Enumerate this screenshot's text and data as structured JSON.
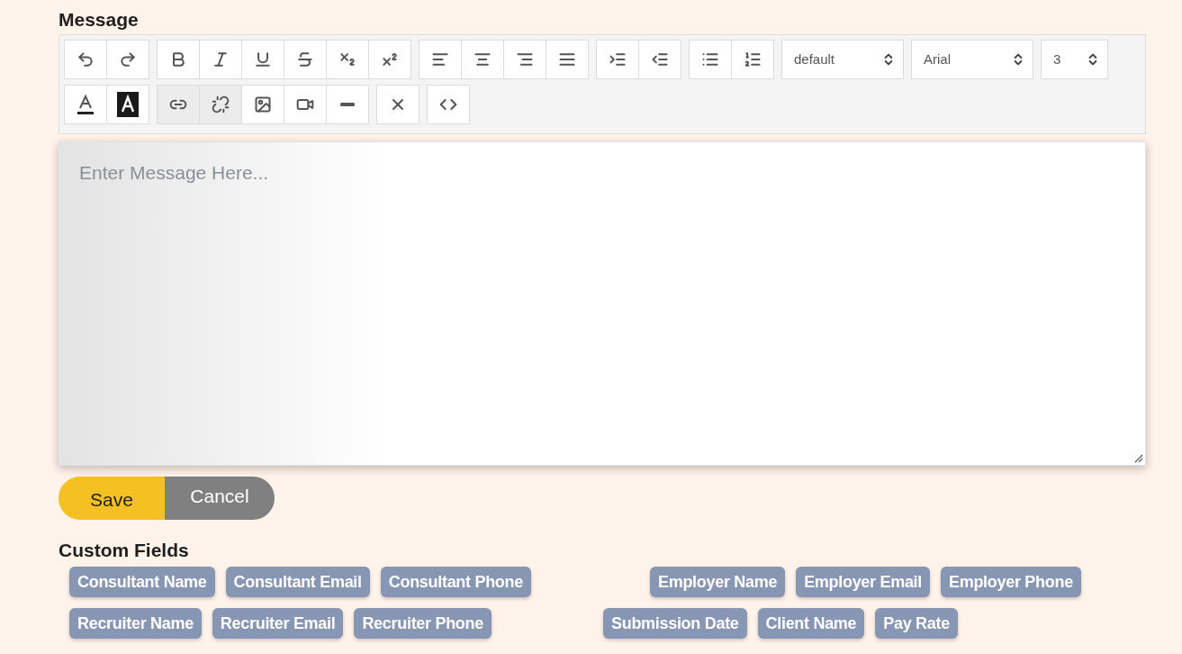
{
  "message_label": "Message",
  "toolbar": {
    "rows": [
      [
        {
          "buttons": [
            {
              "kind": "undo",
              "pressed": false
            },
            {
              "kind": "redo",
              "pressed": false
            }
          ]
        },
        {
          "buttons": [
            {
              "kind": "bold",
              "pressed": false
            },
            {
              "kind": "italic",
              "pressed": false
            },
            {
              "kind": "underline",
              "pressed": false
            },
            {
              "kind": "strikethrough",
              "pressed": false
            },
            {
              "kind": "subscript",
              "pressed": false
            },
            {
              "kind": "superscript",
              "pressed": false
            }
          ]
        },
        {
          "buttons": [
            {
              "kind": "align-left",
              "pressed": false
            },
            {
              "kind": "align-center",
              "pressed": false
            },
            {
              "kind": "align-right",
              "pressed": false
            },
            {
              "kind": "justify",
              "pressed": false
            }
          ]
        },
        {
          "buttons": [
            {
              "kind": "indent",
              "pressed": false
            },
            {
              "kind": "outdent",
              "pressed": false
            }
          ]
        },
        {
          "buttons": [
            {
              "kind": "bullet-list",
              "pressed": false
            },
            {
              "kind": "numbered-list",
              "pressed": false
            }
          ]
        }
      ],
      [
        {
          "buttons": [
            {
              "kind": "text-color",
              "pressed": false
            },
            {
              "kind": "highlight",
              "pressed": false
            }
          ]
        },
        {
          "buttons": [
            {
              "kind": "link",
              "pressed": true
            },
            {
              "kind": "unlink",
              "pressed": true
            },
            {
              "kind": "image",
              "pressed": false
            },
            {
              "kind": "video",
              "pressed": false
            },
            {
              "kind": "rule",
              "pressed": false
            }
          ]
        },
        {
          "buttons": [
            {
              "kind": "clear",
              "pressed": false
            }
          ]
        },
        {
          "buttons": [
            {
              "kind": "code",
              "pressed": false
            }
          ]
        }
      ]
    ],
    "selects": [
      {
        "kind": "heading",
        "value": "default"
      },
      {
        "kind": "font",
        "value": "Arial"
      },
      {
        "kind": "size",
        "value": "3"
      }
    ]
  },
  "editor": {
    "placeholder": "Enter Message Here..."
  },
  "buttons": [
    {
      "kind": "primary",
      "label": "Save"
    },
    {
      "kind": "secondary",
      "label": "Cancel"
    }
  ],
  "custom_fields": {
    "title": "Custom Fields",
    "rows": [
      {
        "left": [
          "Consultant Name",
          "Consultant Email",
          "Consultant Phone"
        ],
        "right": [
          "Employer Name",
          "Employer Email",
          "Employer Phone"
        ]
      },
      {
        "left": [
          "Recruiter Name",
          "Recruiter Email",
          "Recruiter Phone"
        ],
        "right": [
          "Submission Date",
          "Client Name",
          "Pay Rate"
        ]
      }
    ]
  }
}
